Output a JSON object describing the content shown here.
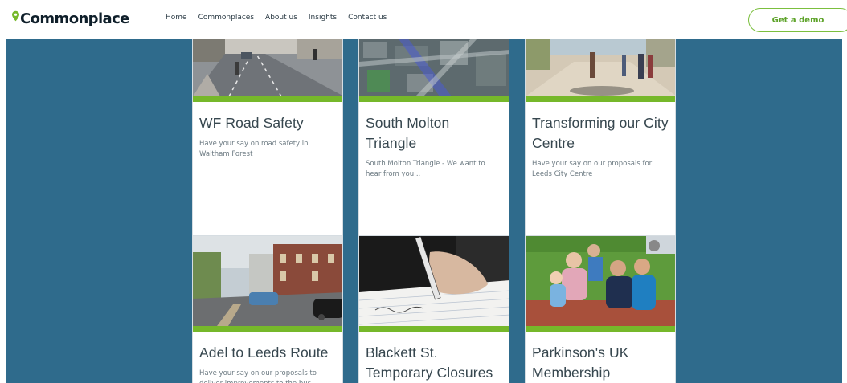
{
  "header": {
    "logo_text": "Commonplace",
    "nav": [
      "Home",
      "Commonplaces",
      "About us",
      "Insights",
      "Contact us"
    ],
    "cta_label": "Get a demo"
  },
  "colors": {
    "brand_green": "#76b82a",
    "main_background": "#2f6b8c",
    "title_text": "#37474f"
  },
  "cards": [
    {
      "title": "WF Road Safety",
      "description": "Have your say on road safety in Waltham Forest",
      "image": "road-street-photo"
    },
    {
      "title": "South Molton Triangle",
      "description": "South Molton Triangle - We want to hear from you...",
      "image": "aerial-map-photo"
    },
    {
      "title": "Transforming our City Centre",
      "description": "Have your say on our proposals for Leeds City Centre",
      "image": "pedestrian-street-photo"
    },
    {
      "title": "Adel to Leeds Route",
      "description": "Have your say on our proposals to deliver improvements to the bus",
      "image": "city-road-buildings-photo"
    },
    {
      "title": "Blackett St. Temporary Closures",
      "description": "",
      "image": "hand-writing-photo"
    },
    {
      "title": "Parkinson's UK Membership",
      "description": "",
      "image": "family-picnic-photo"
    }
  ]
}
